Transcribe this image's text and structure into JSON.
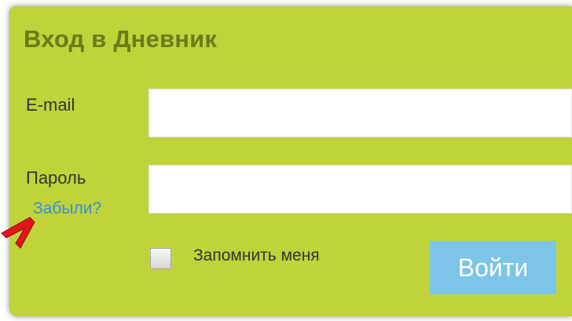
{
  "login_form": {
    "title": "Вход в Дневник",
    "email": {
      "label": "E-mail",
      "value": "",
      "placeholder": ""
    },
    "password": {
      "label": "Пароль",
      "value": "",
      "placeholder": ""
    },
    "forgot_link": "Забыли?",
    "remember_me": {
      "label": "Запомнить меня",
      "checked": false
    },
    "submit_label": "Войти"
  },
  "annotation": {
    "icon": "red-arrow-icon"
  },
  "colors": {
    "panel_background": "#c0d33a",
    "title": "#6d7a1a",
    "link": "#3a8fd0",
    "button_background": "#7cc4e8",
    "arrow": "#e0161c"
  }
}
